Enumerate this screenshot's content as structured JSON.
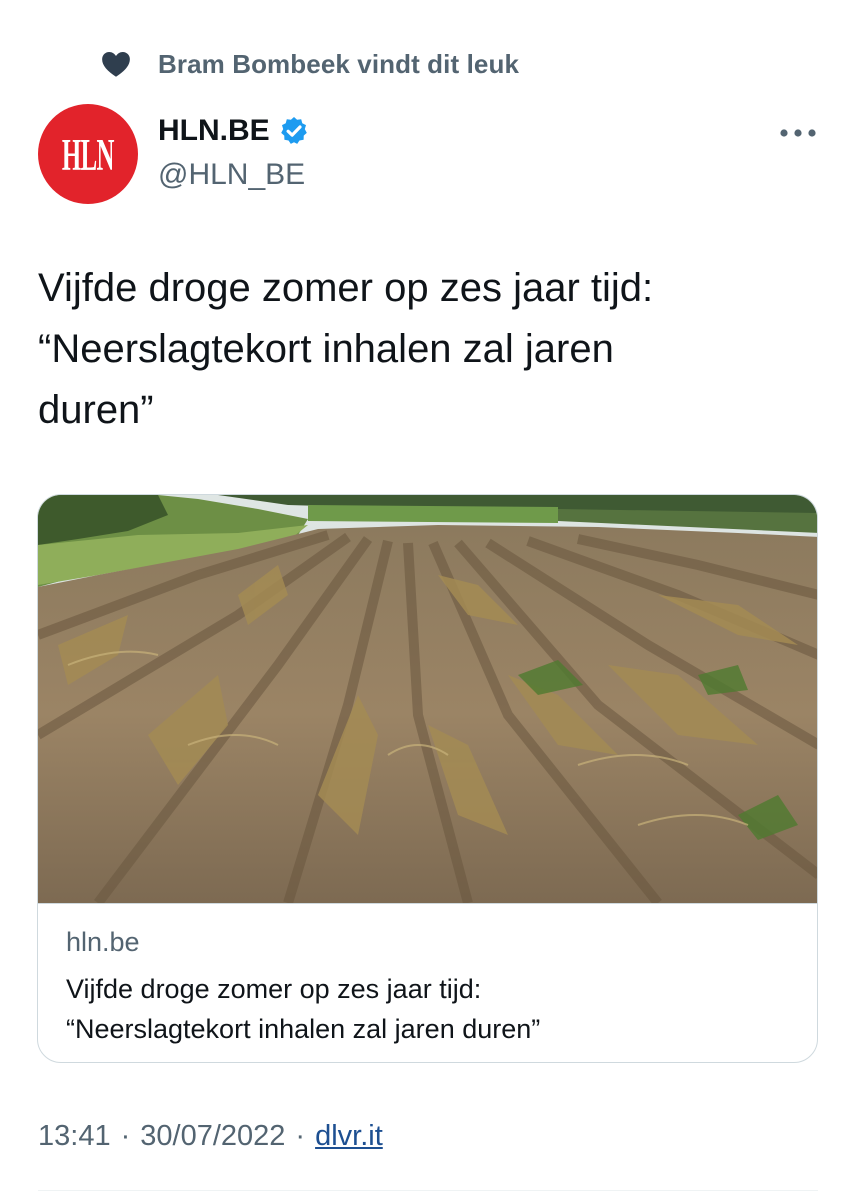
{
  "social_context": {
    "text": "Bram Bombeek vindt dit leuk",
    "icon": "heart-icon"
  },
  "author": {
    "avatar_text": "HLN",
    "display_name": "HLN.BE",
    "handle": "@HLN_BE",
    "verified_icon": "verified-badge-icon",
    "more_icon": "more-options-icon"
  },
  "tweet": {
    "lines": [
      "Vijfde droge zomer op zes jaar tijd:",
      "“Neerslagtekort inhalen zal jaren",
      "duren”"
    ]
  },
  "card": {
    "image": "dry potato field",
    "domain": "hln.be",
    "title_lines": [
      "Vijfde droge zomer op zes jaar tijd:",
      "“Neerslagtekort inhalen zal jaren duren”"
    ]
  },
  "meta": {
    "time": "13:41",
    "separator": "·",
    "date": "30/07/2022",
    "source": "dlvr.it"
  },
  "colors": {
    "avatar_bg": "#e2232b",
    "verified": "#1d9bf0",
    "secondary_text": "#536471",
    "link": "#1d4f91"
  }
}
